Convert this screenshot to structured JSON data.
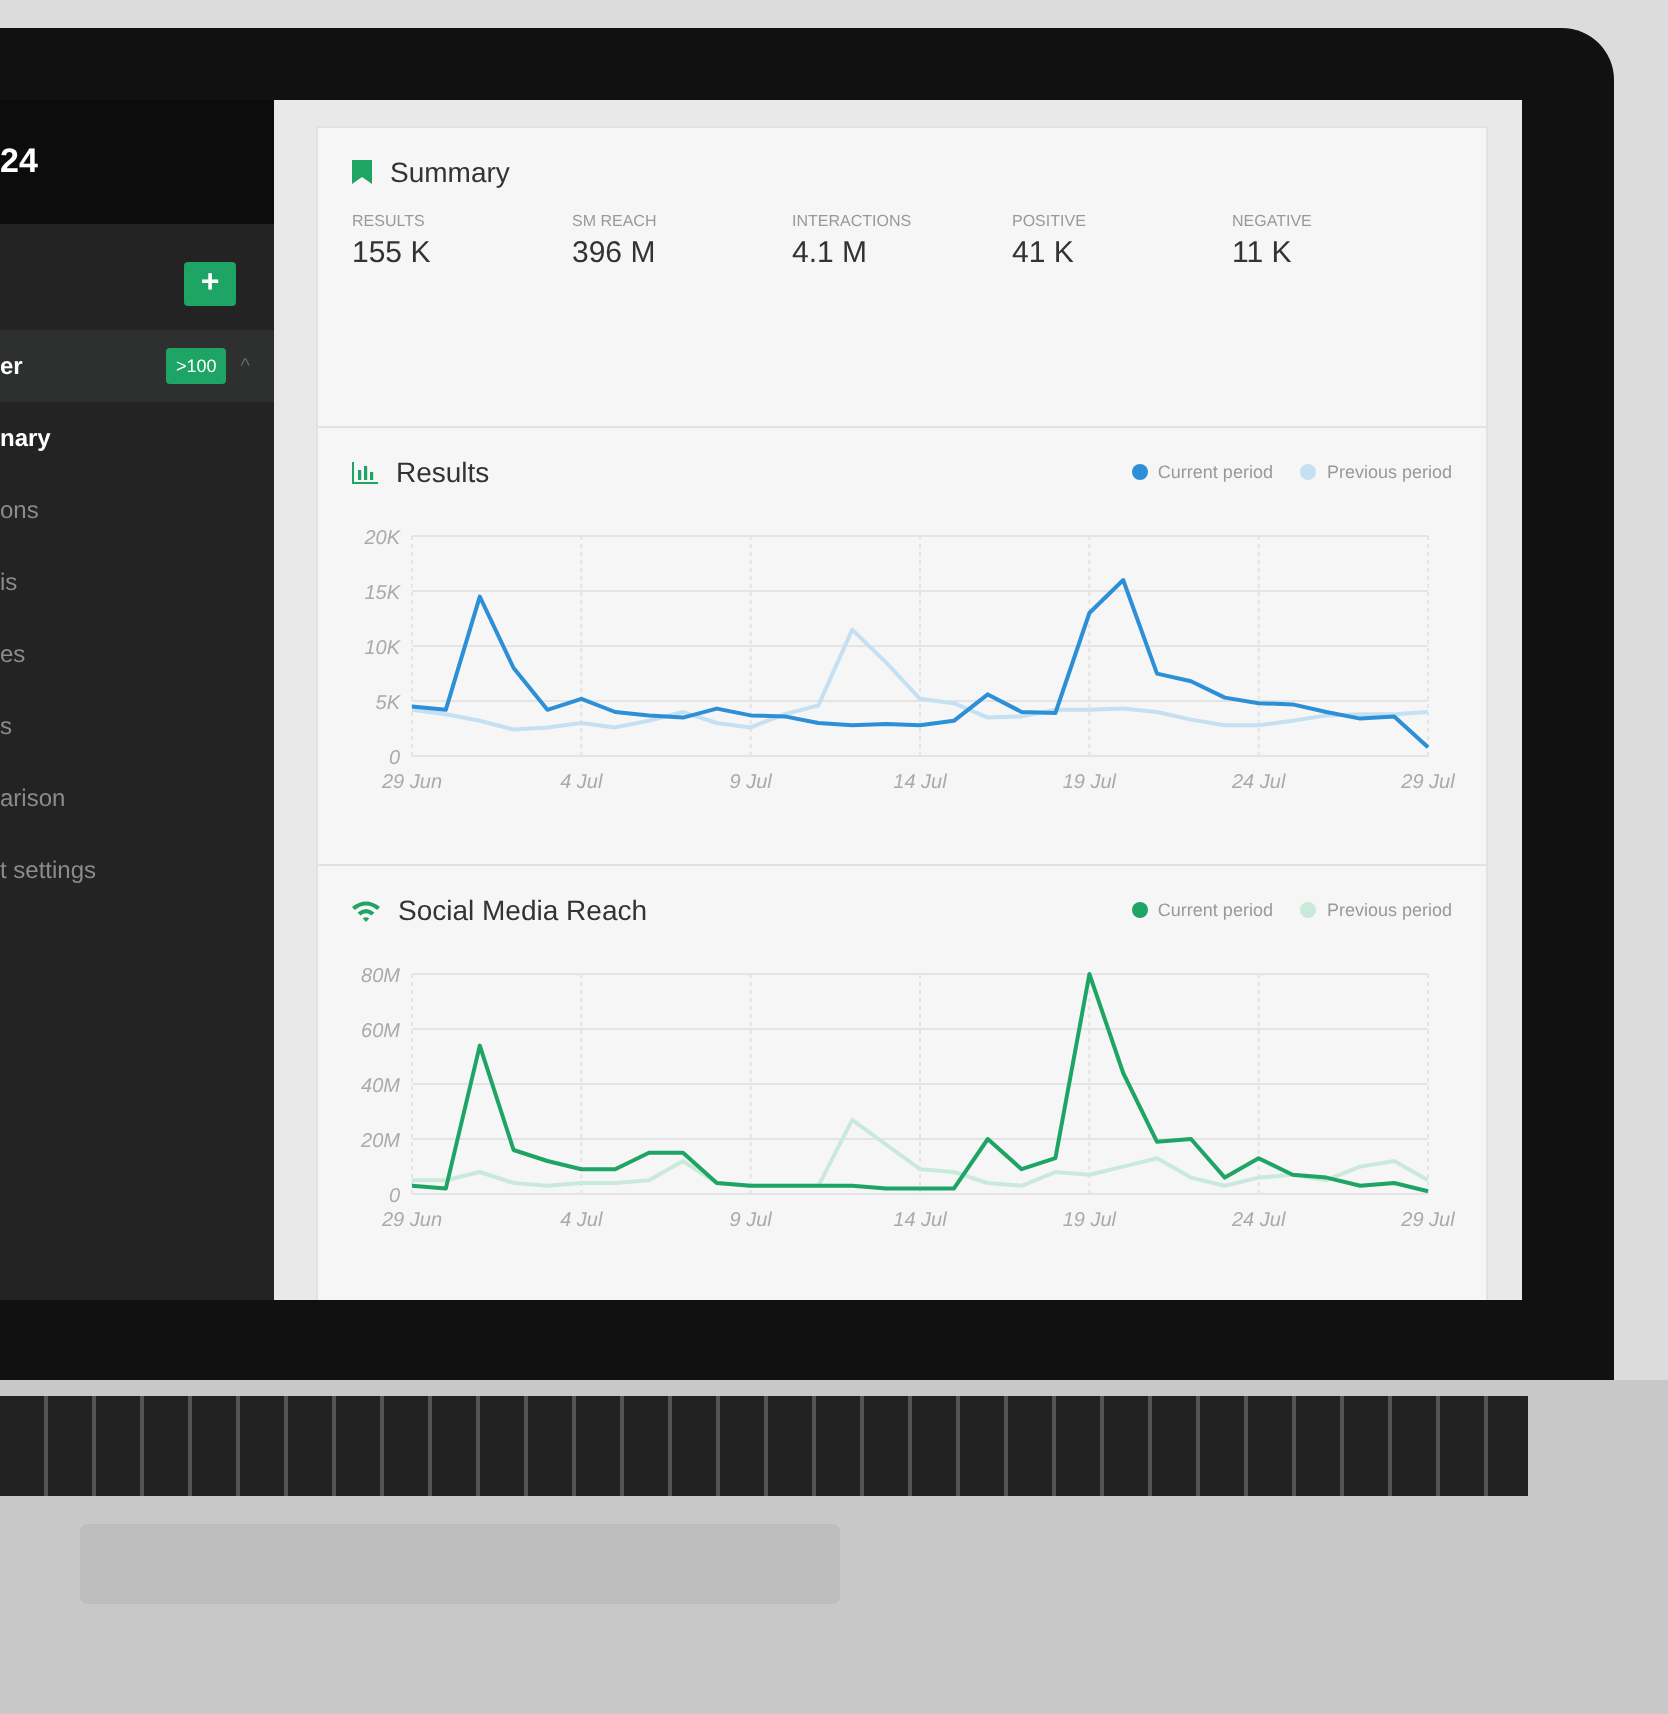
{
  "sidebar": {
    "title": "24",
    "add_button": "+",
    "project": {
      "label": "er",
      "badge": ">100",
      "caret": "^",
      "expanded": true
    },
    "items": [
      {
        "label": "nary",
        "selected": true
      },
      {
        "label": "ons",
        "selected": false
      },
      {
        "label": "is",
        "selected": false
      },
      {
        "label": "es",
        "selected": false
      },
      {
        "label": "s",
        "selected": false
      },
      {
        "label": "arison",
        "selected": false
      },
      {
        "label": "t settings",
        "selected": false
      }
    ]
  },
  "summary": {
    "title": "Summary",
    "stats": [
      {
        "label": "RESULTS",
        "value": "155 K"
      },
      {
        "label": "SM REACH",
        "value": "396 M"
      },
      {
        "label": "INTERACTIONS",
        "value": "4.1 M"
      },
      {
        "label": "POSITIVE",
        "value": "41 K"
      },
      {
        "label": "NEGATIVE",
        "value": "11 K"
      }
    ]
  },
  "charts": [
    {
      "chart_data": {
        "type": "line",
        "title": "Results",
        "grid": true,
        "categories": [
          "29 Jun",
          null,
          null,
          null,
          null,
          "4 Jul",
          null,
          null,
          null,
          null,
          "9 Jul",
          null,
          null,
          null,
          null,
          "14 Jul",
          null,
          null,
          null,
          null,
          "19 Jul",
          null,
          null,
          null,
          null,
          "24 Jul",
          null,
          null,
          null,
          null,
          "29 Jul"
        ],
        "ylim": [
          0,
          20000
        ],
        "yticks": [
          {
            "value": 0,
            "label": "0"
          },
          {
            "value": 5000,
            "label": "5K"
          },
          {
            "value": 10000,
            "label": "10K"
          },
          {
            "value": 15000,
            "label": "15K"
          },
          {
            "value": 20000,
            "label": "20K"
          }
        ],
        "series": [
          {
            "name": "Current period",
            "color": "#2d8fd5",
            "values": [
              4500,
              4200,
              14500,
              8000,
              4200,
              5200,
              4000,
              3700,
              3500,
              4300,
              3700,
              3600,
              3000,
              2800,
              2900,
              2800,
              3200,
              5600,
              4000,
              3900,
              13000,
              16000,
              7500,
              6800,
              5300,
              4800,
              4700,
              4000,
              3400,
              3600,
              800
            ]
          },
          {
            "name": "Previous period",
            "color": "#c5e0f2",
            "values": [
              4200,
              3800,
              3200,
              2400,
              2600,
              3000,
              2600,
              3200,
              4000,
              3000,
              2600,
              3800,
              4600,
              11500,
              8500,
              5200,
              4800,
              3500,
              3600,
              4200,
              4200,
              4300,
              4000,
              3300,
              2800,
              2800,
              3200,
              3700,
              3800,
              3800,
              4000
            ]
          }
        ]
      }
    },
    {
      "chart_data": {
        "type": "line",
        "title": "Social Media Reach",
        "grid": true,
        "categories": [
          "29 Jun",
          null,
          null,
          null,
          null,
          "4 Jul",
          null,
          null,
          null,
          null,
          "9 Jul",
          null,
          null,
          null,
          null,
          "14 Jul",
          null,
          null,
          null,
          null,
          "19 Jul",
          null,
          null,
          null,
          null,
          "24 Jul",
          null,
          null,
          null,
          null,
          "29 Jul"
        ],
        "ylim": [
          0,
          80000000
        ],
        "yticks": [
          {
            "value": 0,
            "label": "0"
          },
          {
            "value": 20000000,
            "label": "20M"
          },
          {
            "value": 40000000,
            "label": "40M"
          },
          {
            "value": 60000000,
            "label": "60M"
          },
          {
            "value": 80000000,
            "label": "80M"
          }
        ],
        "series": [
          {
            "name": "Current period",
            "color": "#1ea464",
            "values": [
              3000000,
              2000000,
              54000000,
              16000000,
              12000000,
              9000000,
              9000000,
              15000000,
              15000000,
              4000000,
              3000000,
              3000000,
              3000000,
              3000000,
              2000000,
              2000000,
              2000000,
              20000000,
              9000000,
              13000000,
              80000000,
              44000000,
              19000000,
              20000000,
              6000000,
              13000000,
              7000000,
              6000000,
              3000000,
              4000000,
              1000000
            ]
          },
          {
            "name": "Previous period",
            "color": "#c9eadb",
            "values": [
              5000000,
              5000000,
              8000000,
              4000000,
              3000000,
              4000000,
              4000000,
              5000000,
              12000000,
              4000000,
              3000000,
              3000000,
              3000000,
              27000000,
              18000000,
              9000000,
              8000000,
              4000000,
              3000000,
              8000000,
              7000000,
              10000000,
              13000000,
              6000000,
              3000000,
              6000000,
              7000000,
              5000000,
              10000000,
              12000000,
              5000000
            ]
          }
        ]
      }
    }
  ]
}
